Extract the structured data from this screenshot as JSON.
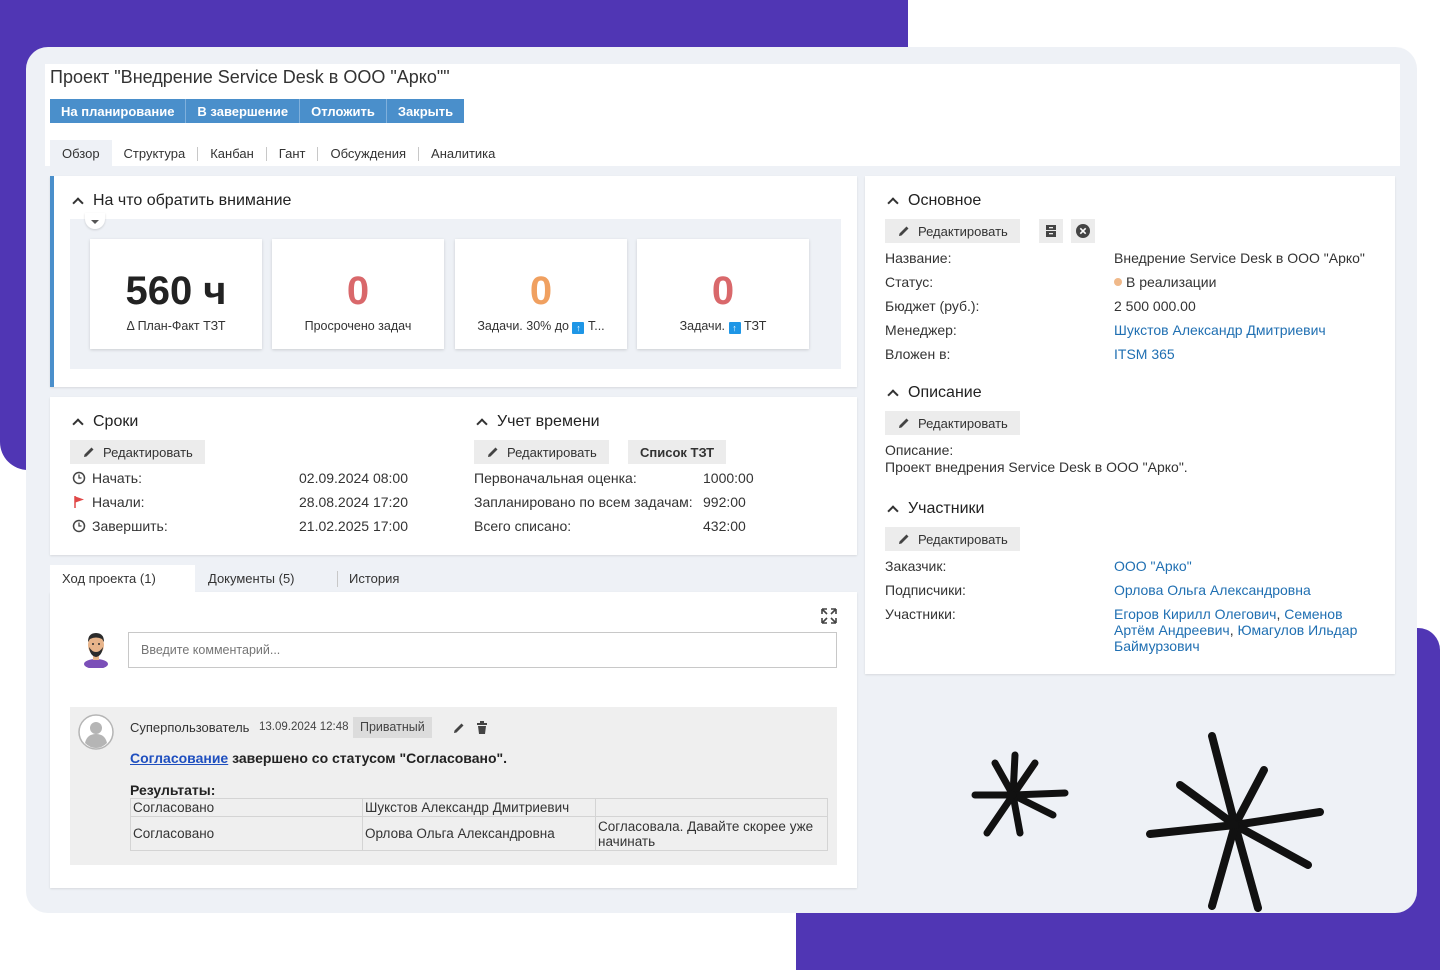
{
  "page": {
    "title": "Проект \"Внедрение Service Desk в ООО \"Арко\"\"",
    "actions": [
      "На планирование",
      "В завершение",
      "Отложить",
      "Закрыть"
    ],
    "tabs": [
      "Обзор",
      "Структура",
      "Канбан",
      "Гант",
      "Обсуждения",
      "Аналитика"
    ],
    "active_tab": "Обзор"
  },
  "attention": {
    "title": "На что обратить внимание",
    "kpis": [
      {
        "value": "560 ч",
        "label": "Δ План-Факт ТЗТ",
        "color": "#222222"
      },
      {
        "value": "0",
        "label": "Просрочено задач",
        "color": "#d9686b"
      },
      {
        "value": "0",
        "label_prefix": "Задачи. 30% до",
        "label_suffix": "Т...",
        "color": "#f0a060"
      },
      {
        "value": "0",
        "label_prefix": "Задачи.",
        "label_suffix": "ТЗТ",
        "color": "#d9686b"
      }
    ]
  },
  "deadlines": {
    "title": "Сроки",
    "edit": "Редактировать",
    "rows": [
      {
        "label": "Начать:",
        "value": "02.09.2024 08:00"
      },
      {
        "label": "Начали:",
        "value": "28.08.2024 17:20"
      },
      {
        "label": "Завершить:",
        "value": "21.02.2025 17:00"
      }
    ]
  },
  "time": {
    "title": "Учет времени",
    "edit": "Редактировать",
    "list": "Список ТЗТ",
    "rows": [
      {
        "label": "Первоначальная оценка:",
        "value": "1000:00"
      },
      {
        "label": "Запланировано по всем задачам:",
        "value": "992:00"
      },
      {
        "label": "Всего списано:",
        "value": "432:00"
      }
    ]
  },
  "comments": {
    "tabs": [
      "Ход проекта (1)",
      "Документы (5)",
      "История"
    ],
    "placeholder": "Введите комментарий...",
    "entry": {
      "author": "Суперпользователь",
      "date": "13.09.2024 12:48",
      "badge": "Приватный",
      "link": "Согласование",
      "text": " завершено со статусом \"Согласовано\".",
      "results_label": "Результаты:",
      "results": [
        [
          "Согласовано",
          "Шукстов Александр Дмитриевич",
          ""
        ],
        [
          "Согласовано",
          "Орлова Ольга Александровна",
          "Согласовала. Давайте скорее уже начинать"
        ]
      ]
    }
  },
  "main_info": {
    "title": "Основное",
    "edit": "Редактировать",
    "name_label": "Название:",
    "name": "Внедрение Service Desk в ООО \"Арко\"",
    "status_label": "Статус:",
    "status": "В реализации",
    "status_color": "#f0b98a",
    "budget_label": "Бюджет (руб.):",
    "budget": "2 500 000.00",
    "manager_label": "Менеджер:",
    "manager": "Шукстов Александр Дмитриевич",
    "parent_label": "Вложен в:",
    "parent": "ITSM 365"
  },
  "description": {
    "title": "Описание",
    "edit": "Редактировать",
    "label": "Описание:",
    "text": "Проект внедрения Service Desk в ООО \"Арко\"."
  },
  "members": {
    "title": "Участники",
    "edit": "Редактировать",
    "customer_label": "Заказчик:",
    "customer": "ООО \"Арко\"",
    "subscribers_label": "Подписчики:",
    "subscribers": "Орлова Ольга Александровна",
    "participants_label": "Участники:",
    "participants": [
      "Егоров Кирилл Олегович",
      "Семенов Артём Андреевич",
      "Юмагулов Ильдар Баймурзович"
    ]
  }
}
